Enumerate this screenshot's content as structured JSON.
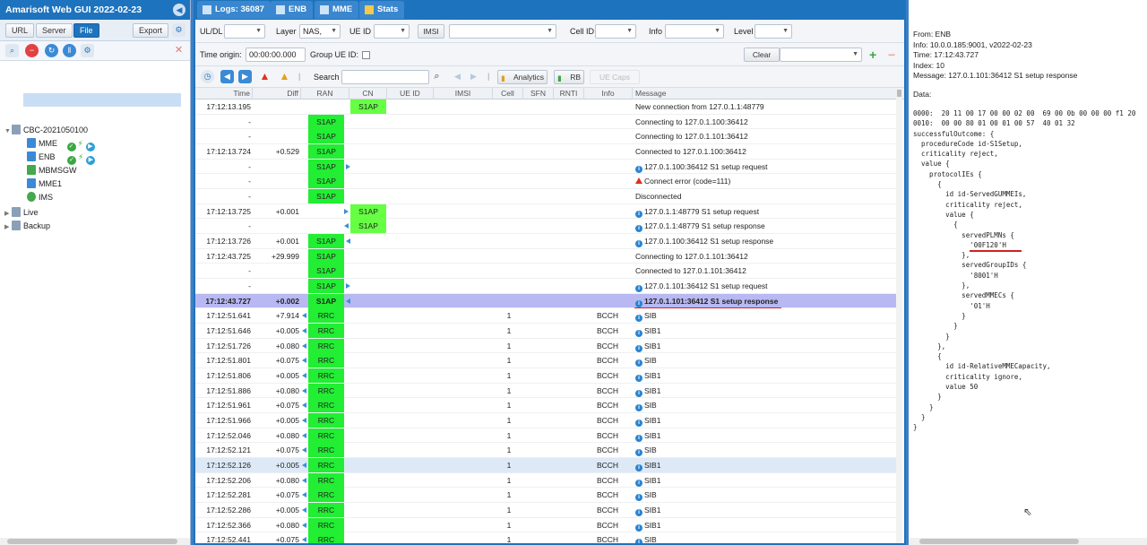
{
  "app": {
    "title": "Amarisoft Web GUI 2022-02-23"
  },
  "left": {
    "toolbar": {
      "url": "URL",
      "server": "Server",
      "file": "File",
      "export": "Export"
    },
    "tree": [
      {
        "label": "CBC-2021050100",
        "level": 0,
        "icon": "folder"
      },
      {
        "label": "MME",
        "level": 1,
        "icon": "server-blue"
      },
      {
        "label": "ENB",
        "level": 1,
        "icon": "server-antenna"
      },
      {
        "label": "MBMSGW",
        "level": 1,
        "icon": "download-green"
      },
      {
        "label": "MME1",
        "level": 1,
        "icon": "server-blue"
      },
      {
        "label": "IMS",
        "level": 1,
        "icon": "phone-green"
      },
      {
        "label": "Live",
        "level": 0,
        "icon": "folder"
      },
      {
        "label": "Backup",
        "level": 0,
        "icon": "folder"
      }
    ]
  },
  "tabs": [
    {
      "label": "Logs: 36087",
      "icon": "list-icon"
    },
    {
      "label": "ENB",
      "icon": "antenna-icon"
    },
    {
      "label": "MME",
      "icon": "server-icon"
    },
    {
      "label": "Stats",
      "icon": "chart-icon"
    }
  ],
  "filters": {
    "uldl": {
      "label": "UL/DL",
      "value": ""
    },
    "layer": {
      "label": "Layer",
      "value": "NAS,"
    },
    "ueid": {
      "label": "UE ID",
      "value": ""
    },
    "imsi": {
      "label": "IMSI",
      "value": ""
    },
    "cellid": {
      "label": "Cell ID",
      "value": ""
    },
    "info": {
      "label": "Info",
      "value": ""
    },
    "level": {
      "label": "Level",
      "value": ""
    },
    "time_origin": {
      "label": "Time origin:",
      "value": "00:00:00.000"
    },
    "group_ueid": {
      "label": "Group UE ID:"
    },
    "clear": "Clear",
    "search": {
      "label": "Search",
      "value": ""
    },
    "analytics": "Analytics",
    "rb": "RB",
    "ue_caps": "UE Caps"
  },
  "columns": [
    "Time",
    "Diff",
    "RAN",
    "CN",
    "UE ID",
    "IMSI",
    "Cell",
    "SFN",
    "RNTI",
    "Info",
    "Message"
  ],
  "rows": [
    {
      "time": "17:12:13.195",
      "diff": "",
      "ran": "",
      "cn": "S1AP",
      "cell": "",
      "info": "",
      "msg": "New connection from 127.0.1.1:48779",
      "mi": "",
      "arrow": ""
    },
    {
      "time": "-",
      "diff": "",
      "ran": "S1AP",
      "cn": "",
      "cell": "",
      "info": "",
      "msg": "Connecting to 127.0.1.100:36412",
      "mi": "",
      "arrow": ""
    },
    {
      "time": "-",
      "diff": "",
      "ran": "S1AP",
      "cn": "",
      "cell": "",
      "info": "",
      "msg": "Connecting to 127.0.1.101:36412",
      "mi": "",
      "arrow": ""
    },
    {
      "time": "17:12:13.724",
      "diff": "+0.529",
      "ran": "S1AP",
      "cn": "",
      "cell": "",
      "info": "",
      "msg": "Connected to 127.0.1.100:36412",
      "mi": "",
      "arrow": ""
    },
    {
      "time": "-",
      "diff": "",
      "ran": "S1AP",
      "cn": "",
      "cell": "",
      "info": "",
      "msg": "127.0.1.100:36412 S1 setup request",
      "mi": "i",
      "arrow": "ran-r"
    },
    {
      "time": "-",
      "diff": "",
      "ran": "S1AP",
      "cn": "",
      "cell": "",
      "info": "",
      "msg": "Connect error (code=111)",
      "mi": "w",
      "arrow": ""
    },
    {
      "time": "-",
      "diff": "",
      "ran": "S1AP",
      "cn": "",
      "cell": "",
      "info": "",
      "msg": "Disconnected",
      "mi": "",
      "arrow": ""
    },
    {
      "time": "17:12:13.725",
      "diff": "+0.001",
      "ran": "",
      "cn": "S1AP",
      "cell": "",
      "info": "",
      "msg": "127.0.1.1:48779 S1 setup request",
      "mi": "i",
      "arrow": "cn-r"
    },
    {
      "time": "-",
      "diff": "",
      "ran": "",
      "cn": "S1AP",
      "cell": "",
      "info": "",
      "msg": "127.0.1.1:48779 S1 setup response",
      "mi": "i",
      "arrow": "cn-l"
    },
    {
      "time": "17:12:13.726",
      "diff": "+0.001",
      "ran": "S1AP",
      "cn": "",
      "cell": "",
      "info": "",
      "msg": "127.0.1.100:36412 S1 setup response",
      "mi": "i",
      "arrow": "ran-l"
    },
    {
      "time": "17:12:43.725",
      "diff": "+29.999",
      "ran": "S1AP",
      "cn": "",
      "cell": "",
      "info": "",
      "msg": "Connecting to 127.0.1.101:36412",
      "mi": "",
      "arrow": ""
    },
    {
      "time": "-",
      "diff": "",
      "ran": "S1AP",
      "cn": "",
      "cell": "",
      "info": "",
      "msg": "Connected to 127.0.1.101:36412",
      "mi": "",
      "arrow": ""
    },
    {
      "time": "-",
      "diff": "",
      "ran": "S1AP",
      "cn": "",
      "cell": "",
      "info": "",
      "msg": "127.0.1.101:36412 S1 setup request",
      "mi": "i",
      "arrow": "ran-r"
    },
    {
      "time": "17:12:43.727",
      "diff": "+0.002",
      "ran": "S1AP",
      "cn": "",
      "cell": "",
      "info": "",
      "msg": "127.0.1.101:36412 S1 setup response",
      "mi": "i",
      "arrow": "ran-l",
      "selected": true
    },
    {
      "time": "17:12:51.641",
      "diff": "+7.914",
      "ran": "RRC",
      "cn": "",
      "cell": "1",
      "info": "BCCH",
      "msg": "SIB",
      "mi": "i",
      "arrow": "pre-l"
    },
    {
      "time": "17:12:51.646",
      "diff": "+0.005",
      "ran": "RRC",
      "cn": "",
      "cell": "1",
      "info": "BCCH",
      "msg": "SIB1",
      "mi": "i",
      "arrow": "pre-l"
    },
    {
      "time": "17:12:51.726",
      "diff": "+0.080",
      "ran": "RRC",
      "cn": "",
      "cell": "1",
      "info": "BCCH",
      "msg": "SIB1",
      "mi": "i",
      "arrow": "pre-l"
    },
    {
      "time": "17:12:51.801",
      "diff": "+0.075",
      "ran": "RRC",
      "cn": "",
      "cell": "1",
      "info": "BCCH",
      "msg": "SIB",
      "mi": "i",
      "arrow": "pre-l"
    },
    {
      "time": "17:12:51.806",
      "diff": "+0.005",
      "ran": "RRC",
      "cn": "",
      "cell": "1",
      "info": "BCCH",
      "msg": "SIB1",
      "mi": "i",
      "arrow": "pre-l"
    },
    {
      "time": "17:12:51.886",
      "diff": "+0.080",
      "ran": "RRC",
      "cn": "",
      "cell": "1",
      "info": "BCCH",
      "msg": "SIB1",
      "mi": "i",
      "arrow": "pre-l"
    },
    {
      "time": "17:12:51.961",
      "diff": "+0.075",
      "ran": "RRC",
      "cn": "",
      "cell": "1",
      "info": "BCCH",
      "msg": "SIB",
      "mi": "i",
      "arrow": "pre-l"
    },
    {
      "time": "17:12:51.966",
      "diff": "+0.005",
      "ran": "RRC",
      "cn": "",
      "cell": "1",
      "info": "BCCH",
      "msg": "SIB1",
      "mi": "i",
      "arrow": "pre-l"
    },
    {
      "time": "17:12:52.046",
      "diff": "+0.080",
      "ran": "RRC",
      "cn": "",
      "cell": "1",
      "info": "BCCH",
      "msg": "SIB1",
      "mi": "i",
      "arrow": "pre-l"
    },
    {
      "time": "17:12:52.121",
      "diff": "+0.075",
      "ran": "RRC",
      "cn": "",
      "cell": "1",
      "info": "BCCH",
      "msg": "SIB",
      "mi": "i",
      "arrow": "pre-l"
    },
    {
      "time": "17:12:52.126",
      "diff": "+0.005",
      "ran": "RRC",
      "cn": "",
      "cell": "1",
      "info": "BCCH",
      "msg": "SIB1",
      "mi": "i",
      "arrow": "pre-l",
      "hover": true
    },
    {
      "time": "17:12:52.206",
      "diff": "+0.080",
      "ran": "RRC",
      "cn": "",
      "cell": "1",
      "info": "BCCH",
      "msg": "SIB1",
      "mi": "i",
      "arrow": "pre-l"
    },
    {
      "time": "17:12:52.281",
      "diff": "+0.075",
      "ran": "RRC",
      "cn": "",
      "cell": "1",
      "info": "BCCH",
      "msg": "SIB",
      "mi": "i",
      "arrow": "pre-l"
    },
    {
      "time": "17:12:52.286",
      "diff": "+0.005",
      "ran": "RRC",
      "cn": "",
      "cell": "1",
      "info": "BCCH",
      "msg": "SIB1",
      "mi": "i",
      "arrow": "pre-l"
    },
    {
      "time": "17:12:52.366",
      "diff": "+0.080",
      "ran": "RRC",
      "cn": "",
      "cell": "1",
      "info": "BCCH",
      "msg": "SIB1",
      "mi": "i",
      "arrow": "pre-l"
    },
    {
      "time": "17:12:52.441",
      "diff": "+0.075",
      "ran": "RRC",
      "cn": "",
      "cell": "1",
      "info": "BCCH",
      "msg": "SIB",
      "mi": "i",
      "arrow": "pre-l"
    }
  ],
  "detail": {
    "from": "From: ENB",
    "info": "Info: 10.0.0.185:9001, v2022-02-23",
    "time": "Time: 17:12:43.727",
    "index": "Index: 10",
    "message": "Message: 127.0.1.101:36412 S1 setup response",
    "data_label": "Data:",
    "dump": "0000:  20 11 00 17 00 00 02 00  69 00 0b 00 00 00 f1 20\n0010:  00 00 80 01 00 01 00 57  40 01 32\nsuccessfulOutcome: {\n  procedureCode id-S1Setup,\n  criticality reject,\n  value {\n    protocolIEs {\n      {\n        id id-ServedGUMMEIs,\n        criticality reject,\n        value {\n          {\n            servedPLMNs {\n              '00F120'H\n            },\n            servedGroupIDs {\n              '8001'H\n            },\n            servedMMECs {\n              '01'H\n            }\n          }\n        }\n      },\n      {\n        id id-RelativeMMECapacity,\n        criticality ignore,\n        value 50\n      }\n    }\n  }\n}"
  },
  "colors": {
    "brand": "#1e73be",
    "ran_green": "#22ee33",
    "selected_row": "#b8b8f2",
    "underline_red": "#d02020"
  }
}
